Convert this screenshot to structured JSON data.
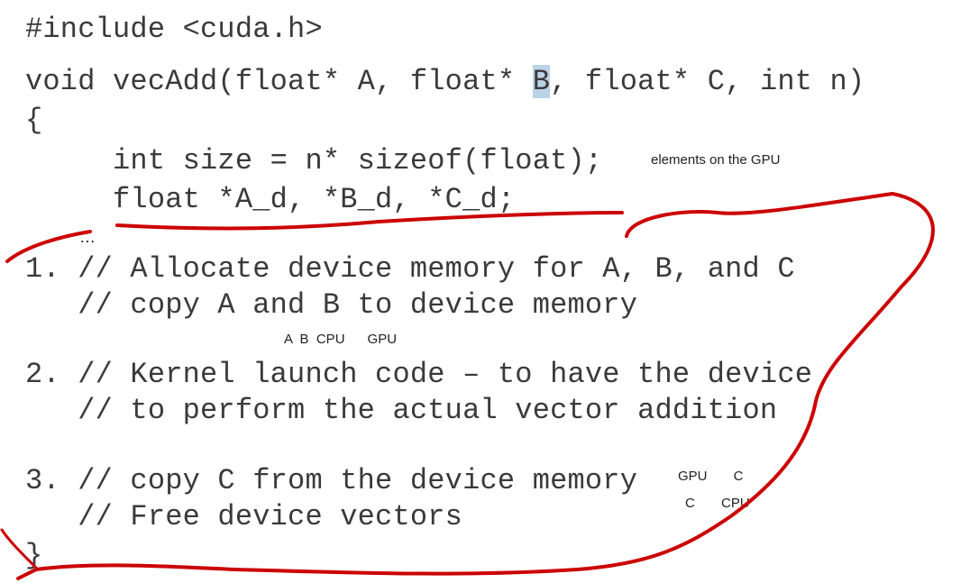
{
  "code_lines": {
    "include": "#include <cuda.h>",
    "sig_pre": "void vecAdd(float* A, float* ",
    "sig_highlight": "B",
    "sig_post": ", float* C, int n)",
    "open_brace": "{",
    "size_line": "     int size = n* sizeof(float);",
    "decl_line": "     float *A_d, *B_d, *C_d;",
    "ellipsis": "…",
    "step1_a": "1. // Allocate device memory for A, B, and C",
    "step1_b": "   // copy A and B to device memory",
    "step2_a": "2. // Kernel launch code – to have the device",
    "step2_b": "   // to perform the actual vector addition",
    "step3_a": "3. // copy C from the device memory",
    "step3_b": "   // Free device vectors",
    "close_brace": "}"
  },
  "annotations": {
    "elements_gpu": "elements on the GPU",
    "ab_cpu_gpu": "A  B  CPU      GPU",
    "gpu_c_top": "GPU       C",
    "c_cpu_bottom": "C       CPU"
  },
  "colors": {
    "code_text": "#3a3a3a",
    "highlight": "#bcd2e6",
    "ink_red": "#cc0000"
  }
}
